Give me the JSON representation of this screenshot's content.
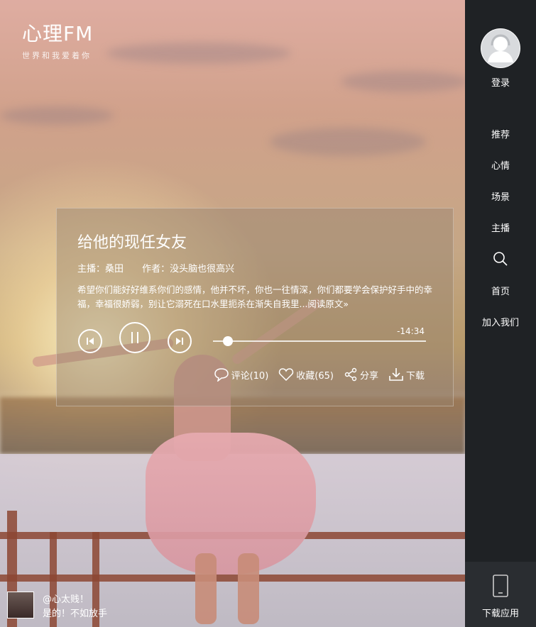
{
  "logo": {
    "title": "心理FM",
    "subtitle": "世界和我爱着你"
  },
  "player": {
    "title": "给他的现任女友",
    "host_label": "主播：桑田",
    "author_label": "作者：没头脑也很高兴",
    "description": "希望你们能好好维系你们的感情，他并不坏，你也一往情深，你们都要学会保护好手中的幸福，幸福很娇弱，别让它溺死在口水里扼杀在渐失自我里...",
    "read_more": "阅读原文»",
    "time_remaining": "-14:34",
    "progress": 0.07,
    "comments": "评论(10)",
    "favorites": "收藏(65)",
    "share": "分享",
    "download": "下载"
  },
  "sidebar": {
    "login": "登录",
    "items": [
      "推荐",
      "心情",
      "场景",
      "主播"
    ],
    "home": "首页",
    "join": "加入我们",
    "download_app": "下载应用"
  },
  "comment": {
    "user": "@心太贱！",
    "text": "是的！不如放手"
  }
}
